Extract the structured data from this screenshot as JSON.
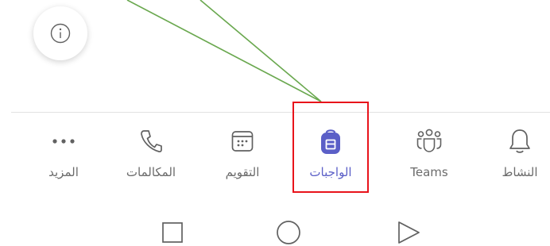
{
  "tabs": [
    {
      "key": "more",
      "label": "المزيد",
      "icon": "more-icon"
    },
    {
      "key": "calls",
      "label": "المكالمات",
      "icon": "phone-icon"
    },
    {
      "key": "calendar",
      "label": "التقويم",
      "icon": "calendar-icon"
    },
    {
      "key": "assignments",
      "label": "الواجبات",
      "icon": "backpack-icon",
      "active": true
    },
    {
      "key": "teams",
      "label": "Teams",
      "icon": "teams-icon"
    },
    {
      "key": "activity",
      "label": "النشاط",
      "icon": "bell-icon"
    }
  ],
  "colors": {
    "accent": "#5b5fc7",
    "icon_gray": "#616161",
    "highlight": "#e8131b",
    "annotation_line": "#6aa84f"
  },
  "system_nav": [
    "recents-square-icon",
    "home-circle-icon",
    "back-triangle-icon"
  ]
}
